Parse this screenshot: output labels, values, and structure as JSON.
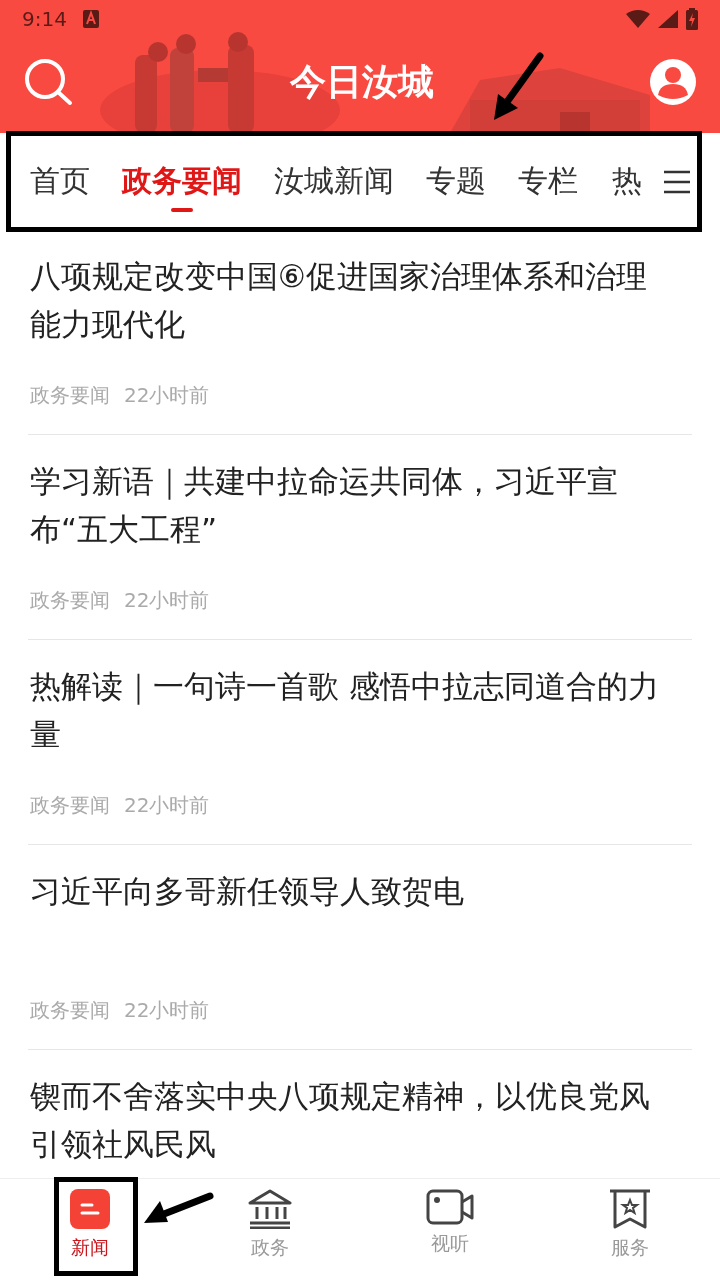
{
  "status_bar": {
    "time": "9:14"
  },
  "header": {
    "title": "今日汝城"
  },
  "tabs": [
    {
      "label": "首页",
      "selected": false
    },
    {
      "label": "政务要闻",
      "selected": true
    },
    {
      "label": "汝城新闻",
      "selected": false
    },
    {
      "label": "专题",
      "selected": false
    },
    {
      "label": "专栏",
      "selected": false
    },
    {
      "label": "热",
      "selected": false
    }
  ],
  "articles": [
    {
      "title": "八项规定改变中国⑥促进国家治理体系和治理能力现代化",
      "category": "政务要闻",
      "time": "22小时前"
    },
    {
      "title": "学习新语｜共建中拉命运共同体，习近平宣布“五大工程”",
      "category": "政务要闻",
      "time": "22小时前"
    },
    {
      "title": "热解读｜一句诗一首歌 感悟中拉志同道合的力量",
      "category": "政务要闻",
      "time": "22小时前"
    },
    {
      "title": "习近平向多哥新任领导人致贺电",
      "category": "政务要闻",
      "time": "22小时前"
    },
    {
      "title": "锲而不舍落实中央八项规定精神，以优良党风引领社风民风"
    }
  ],
  "bottom_nav": [
    {
      "label": "新闻",
      "selected": true
    },
    {
      "label": "政务",
      "selected": false
    },
    {
      "label": "视听",
      "selected": false
    },
    {
      "label": "服务",
      "selected": false
    }
  ]
}
